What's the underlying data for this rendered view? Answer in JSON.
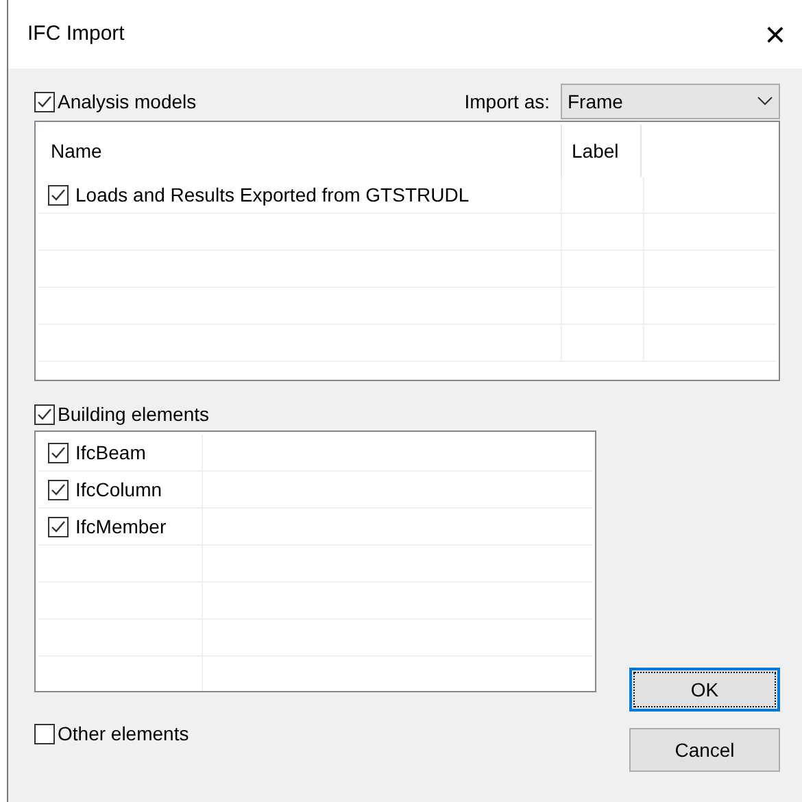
{
  "window": {
    "title": "IFC Import",
    "close": "×"
  },
  "analysis_models": {
    "label": "Analysis models",
    "checked": true
  },
  "import_as": {
    "label": "Import as:",
    "value": "Frame"
  },
  "analysis_table": {
    "columns": [
      "Name",
      "Label"
    ],
    "rows": [
      {
        "name": "Loads and Results Exported from GTSTRUDL",
        "checked": true
      }
    ]
  },
  "building_elements": {
    "label": "Building elements",
    "checked": true
  },
  "building_list": [
    {
      "name": "IfcBeam",
      "checked": true
    },
    {
      "name": "IfcColumn",
      "checked": true
    },
    {
      "name": "IfcMember",
      "checked": true
    }
  ],
  "other_elements": {
    "label": "Other elements",
    "checked": false
  },
  "buttons": [
    {
      "label": "OK",
      "selected": true
    },
    {
      "label": "Cancel",
      "selected": false
    }
  ]
}
